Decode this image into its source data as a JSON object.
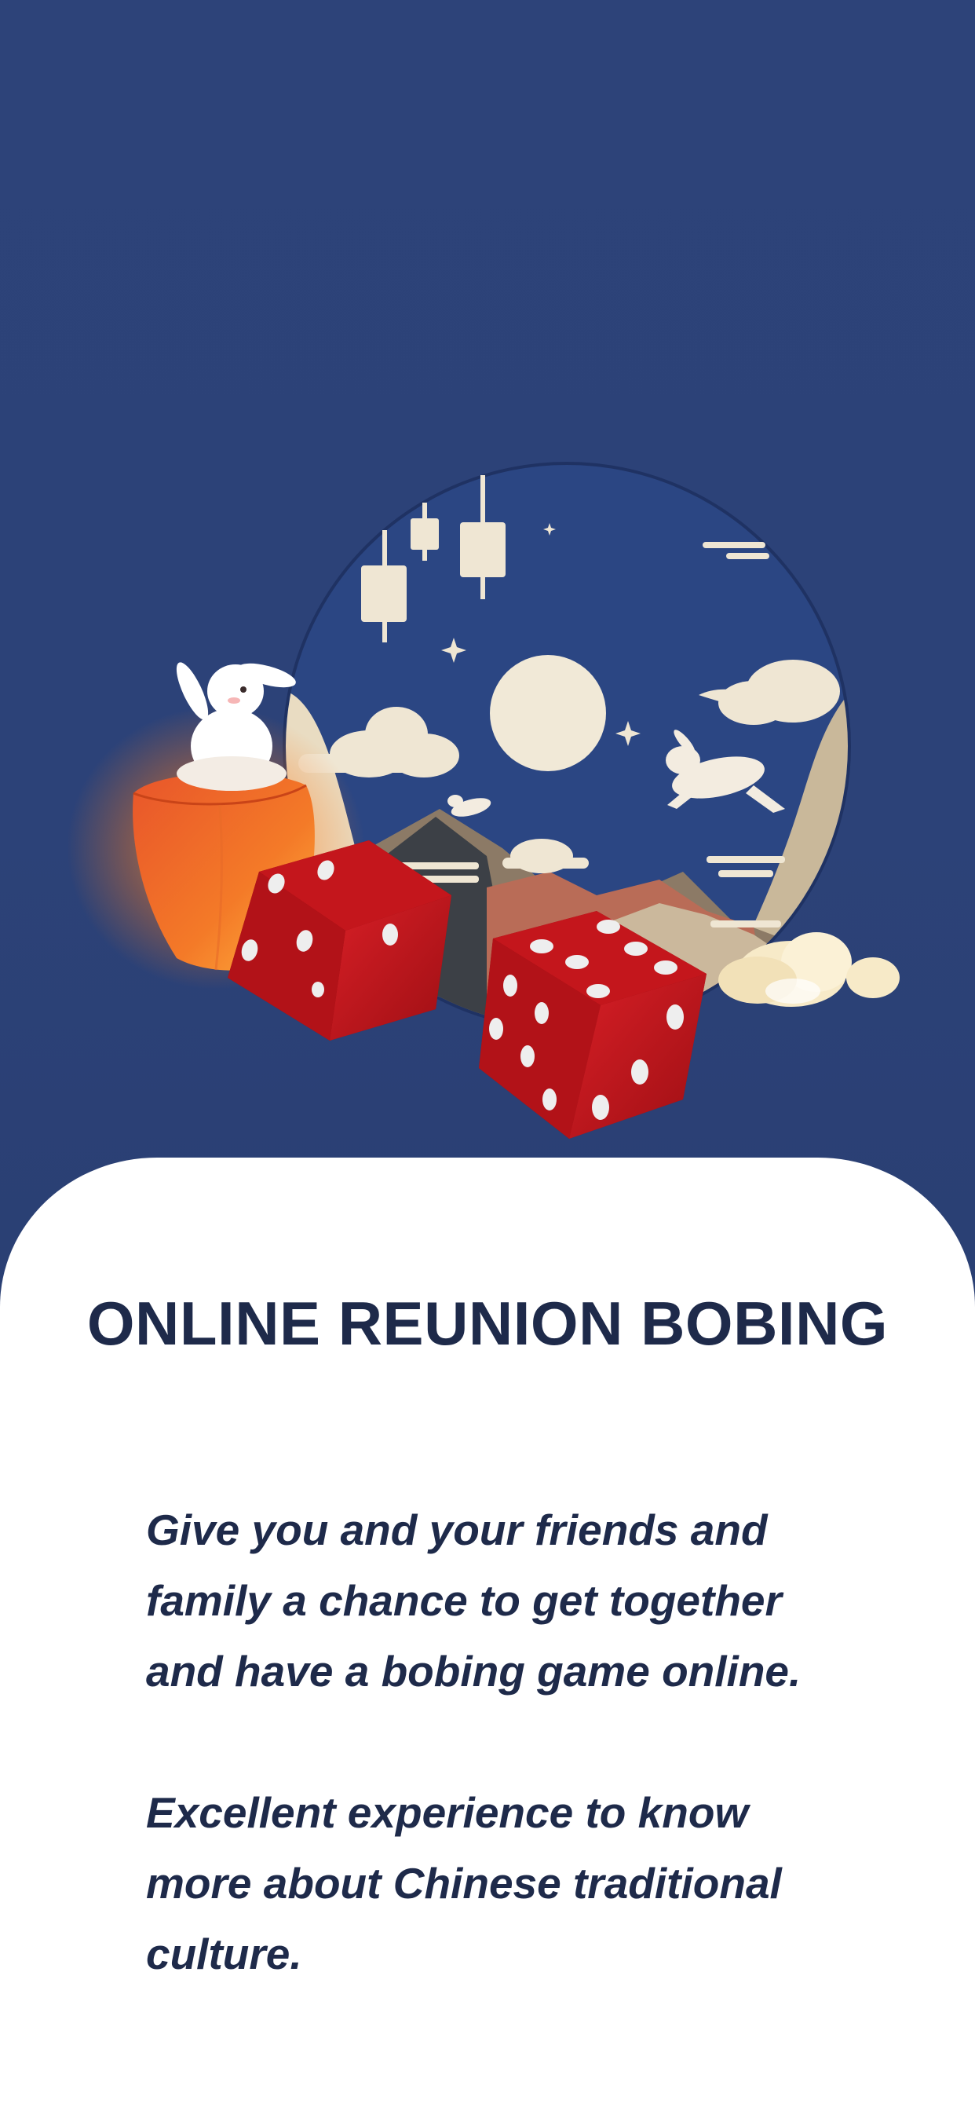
{
  "onboarding": {
    "title": "ONLINE REUNION BOBING",
    "paragraphs": [
      "Give you and your friends and family a chance to get together and have a bobing game online.",
      "Excellent experience to know more about Chinese traditional culture."
    ]
  },
  "illustration": {
    "icons": [
      "moon-icon",
      "rabbit-icon",
      "sky-lantern-icon",
      "dice-icon",
      "cloud-icon",
      "lantern-icon"
    ]
  },
  "colors": {
    "background": "#2c4279",
    "card": "#ffffff",
    "text": "#1e2a4a",
    "dice": "#c4161c",
    "moon": "#f1e9d7"
  }
}
